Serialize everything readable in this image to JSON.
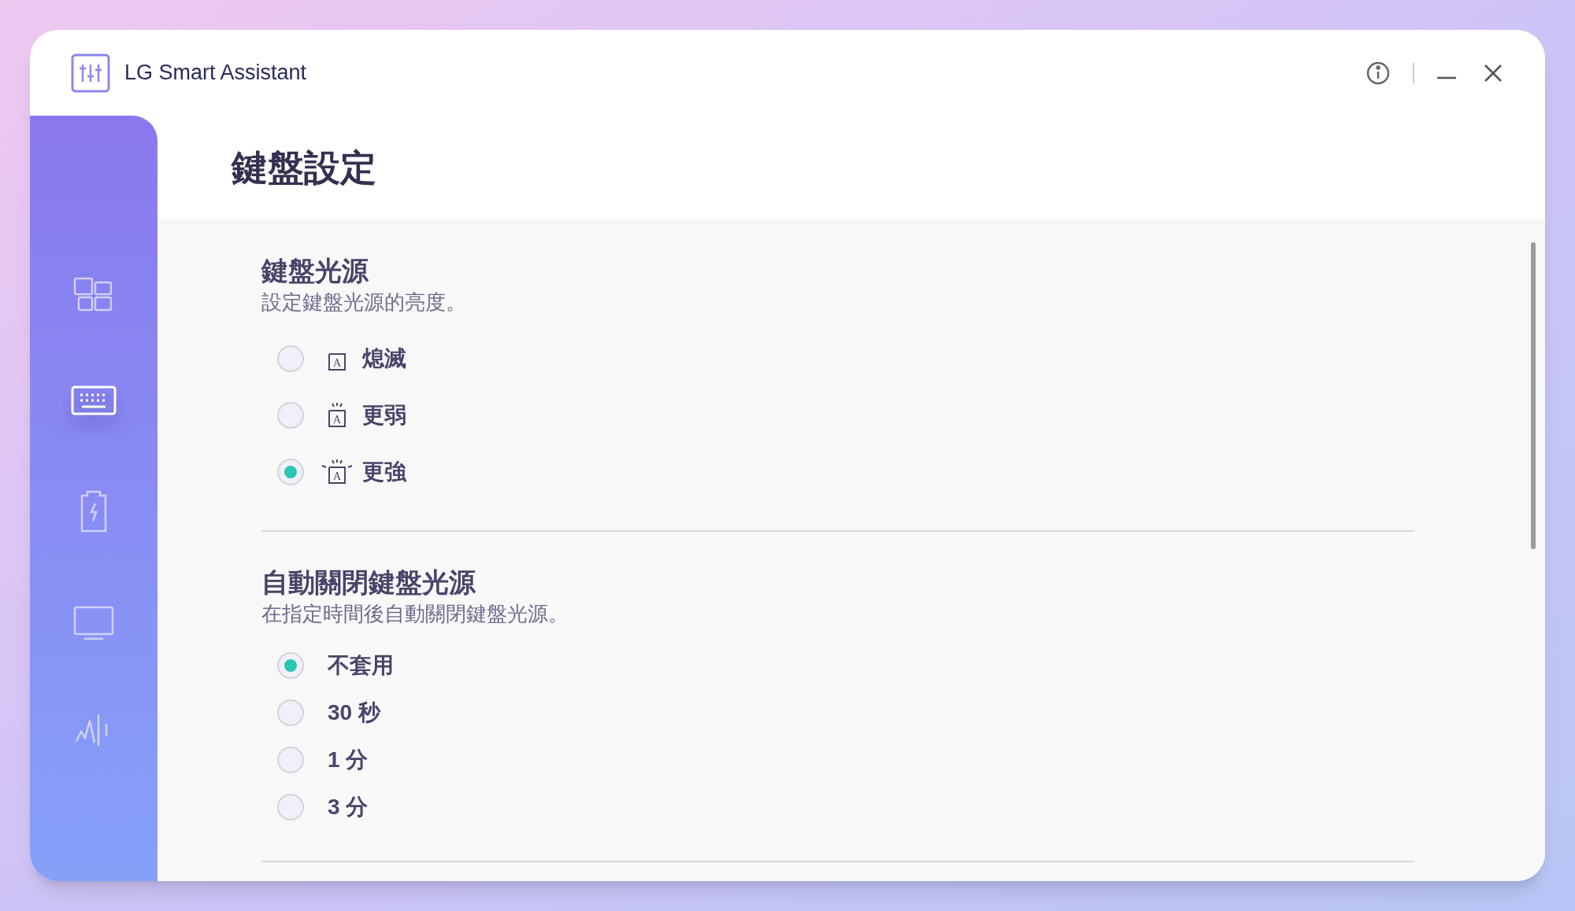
{
  "window": {
    "title": "LG Smart Assistant"
  },
  "sidebar": {
    "items": [
      {
        "kind": "dashboard",
        "selected": false
      },
      {
        "kind": "keyboard",
        "selected": true
      },
      {
        "kind": "battery",
        "selected": false
      },
      {
        "kind": "display",
        "selected": false
      },
      {
        "kind": "audio",
        "selected": false
      }
    ]
  },
  "page_title": "鍵盤設定",
  "sections": [
    {
      "heading": "鍵盤光源",
      "description": "設定鍵盤光源的亮度。",
      "options": [
        {
          "label": "熄滅",
          "kind": "off",
          "glyph": "A",
          "selected": false
        },
        {
          "label": "更弱",
          "kind": "low",
          "glyph": "A",
          "selected": false
        },
        {
          "label": "更強",
          "kind": "high",
          "glyph": "A",
          "selected": true
        }
      ]
    },
    {
      "heading": "自動關閉鍵盤光源",
      "description": "在指定時間後自動關閉鍵盤光源。",
      "options": [
        {
          "label": "不套用",
          "kind": "plain",
          "selected": true
        },
        {
          "label": "30 秒",
          "kind": "plain",
          "selected": false
        },
        {
          "label": "1 分",
          "kind": "plain",
          "selected": false
        },
        {
          "label": "3 分",
          "kind": "plain",
          "selected": false
        }
      ]
    }
  ]
}
